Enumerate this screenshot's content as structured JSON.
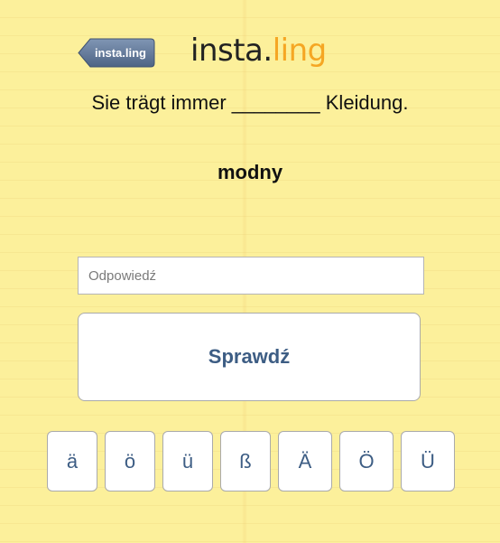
{
  "header": {
    "back_label": "insta.ling",
    "logo_part1": "insta.",
    "logo_part2": "ling"
  },
  "question": {
    "sentence": "Sie trägt immer ________ Kleidung.",
    "translation": "modny"
  },
  "answer": {
    "placeholder": "Odpowiedź",
    "value": ""
  },
  "check_button_label": "Sprawdź",
  "special_chars": [
    "ä",
    "ö",
    "ü",
    "ß",
    "Ä",
    "Ö",
    "Ü"
  ],
  "colors": {
    "background": "#fcf09b",
    "accent": "#3d5d84",
    "logo_orange": "#f5a623"
  }
}
